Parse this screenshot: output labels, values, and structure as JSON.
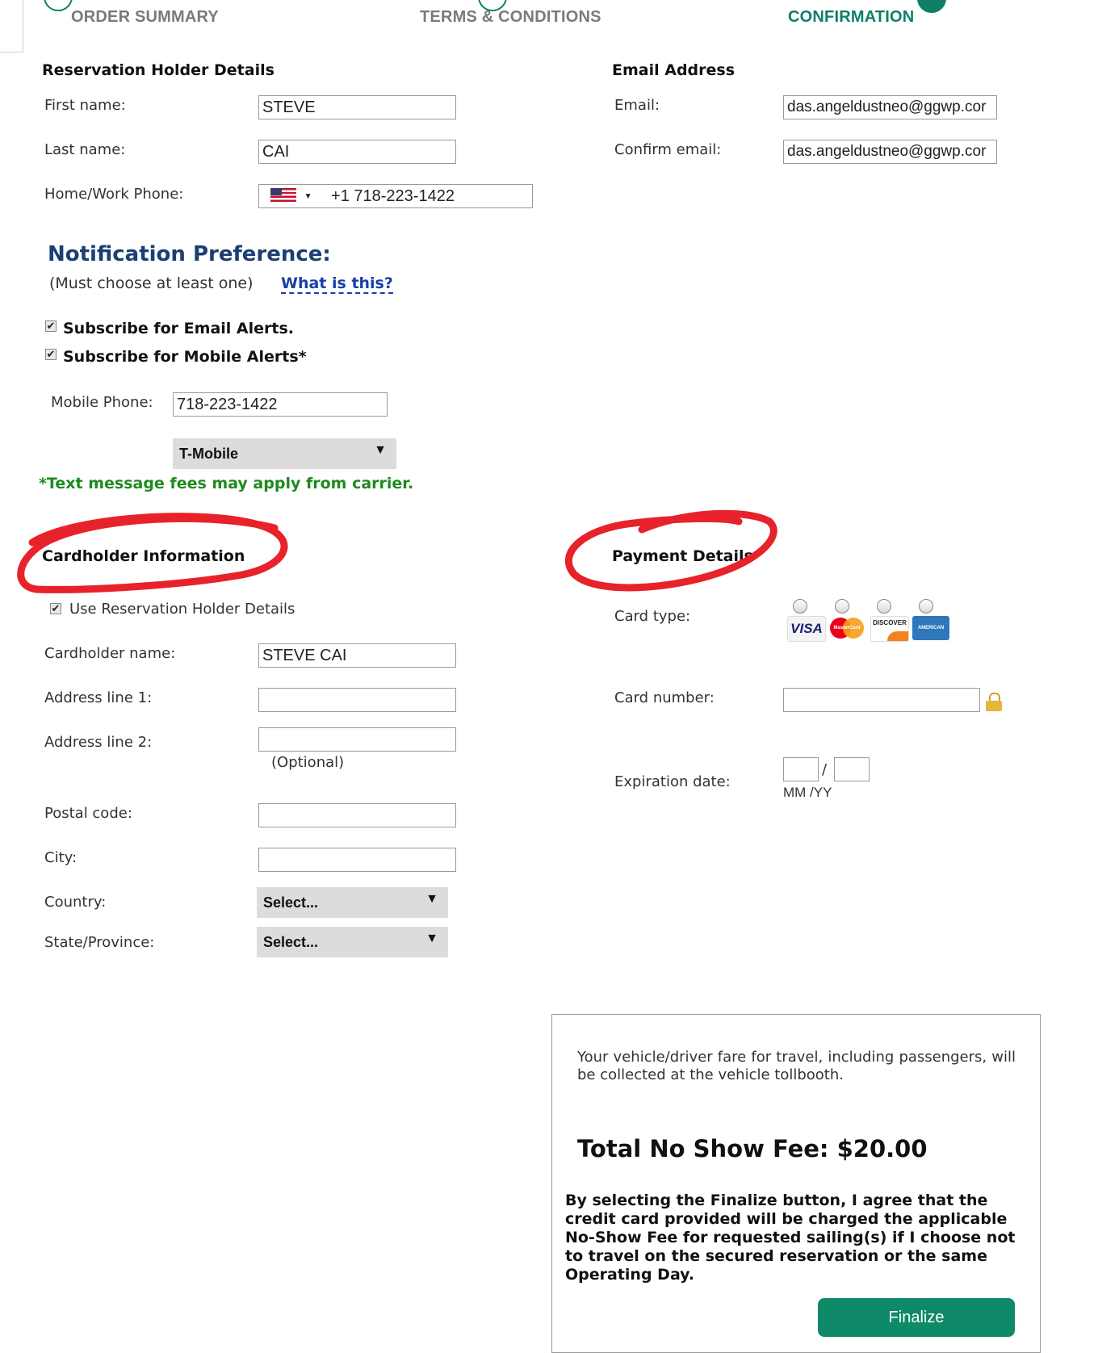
{
  "steps": {
    "order_summary": "ORDER SUMMARY",
    "terms": "TERMS & CONDITIONS",
    "confirmation": "CONFIRMATION"
  },
  "reservation": {
    "title": "Reservation Holder Details",
    "first_name_label": "First name:",
    "first_name_value": "STEVE",
    "last_name_label": "Last name:",
    "last_name_value": "CAI",
    "phone_label": "Home/Work Phone:",
    "phone_value": "+1 718-223-1422"
  },
  "email": {
    "title": "Email Address",
    "email_label": "Email:",
    "email_value": "das.angeldustneo@ggwp.cor",
    "confirm_label": "Confirm email:",
    "confirm_value": "das.angeldustneo@ggwp.cor"
  },
  "notification": {
    "title": "Notification Preference:",
    "note": "(Must choose at least one)",
    "what_link": "What is this?",
    "email_alerts": "Subscribe for Email Alerts.",
    "mobile_alerts": "Subscribe for Mobile Alerts*",
    "mobile_phone_label": "Mobile Phone:",
    "mobile_phone_value": "718-223-1422",
    "carrier": "T-Mobile",
    "fees_note": "*Text message fees may apply from carrier."
  },
  "cardholder": {
    "title": "Cardholder Information",
    "use_holder": "Use Reservation Holder Details",
    "name_label": "Cardholder name:",
    "name_value": "STEVE CAI",
    "addr1_label": "Address line 1:",
    "addr2_label": "Address line 2:",
    "optional": "(Optional)",
    "postal_label": "Postal code:",
    "city_label": "City:",
    "country_label": "Country:",
    "country_value": "Select...",
    "state_label": "State/Province:",
    "state_value": "Select..."
  },
  "payment": {
    "title": "Payment Details",
    "card_type_label": "Card type:",
    "cards": [
      "VISA",
      "MasterCard",
      "DISCOVER",
      "AMERICAN EXPRESS"
    ],
    "card_number_label": "Card number:",
    "expiration_label": "Expiration date:",
    "slash": "/",
    "mmyy": "MM /YY"
  },
  "summary": {
    "fare_note": "Your vehicle/driver fare for travel, including passengers, will be collected at the vehicle tollbooth.",
    "total": "Total No Show Fee: $20.00",
    "agreement": "By selecting the Finalize button, I agree that the credit card provided will be charged the applicable No-Show Fee for requested sailing(s) if I choose not to travel on the secured reservation or the same Operating Day.",
    "finalize": "Finalize"
  },
  "colors": {
    "accent": "#0e7f66",
    "link": "#1a3fa8",
    "heading_blue": "#1b3f73",
    "fee_green": "#1e8a1e",
    "annotation_red": "#e8222a"
  }
}
